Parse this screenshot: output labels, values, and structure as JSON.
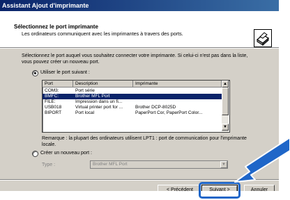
{
  "window": {
    "title": "Assistant Ajout d'imprimante"
  },
  "header": {
    "title": "Sélectionnez le port imprimante",
    "subtitle": "Les ordinateurs communiquent avec les imprimantes à travers des ports.",
    "icon": "printer-icon"
  },
  "instructions": "Sélectionnez le port auquel vous souhaitez connecter votre imprimante. Si celui-ci n'est pas dans la liste, vous pouvez créer un nouveau port.",
  "options": {
    "use_port": {
      "label": "Utiliser le port suivant :",
      "selected": true
    },
    "create_port": {
      "label": "Créer un nouveau port :",
      "selected": false
    }
  },
  "port_list": {
    "columns": [
      "Port",
      "Description",
      "Imprimante"
    ],
    "rows": [
      {
        "port": "COM3:",
        "description": "Port série",
        "printer": "",
        "selected": false
      },
      {
        "port": "BMFC:",
        "description": "Brother MFL Port",
        "printer": "",
        "selected": true
      },
      {
        "port": "FILE:",
        "description": "Impression dans un fi...",
        "printer": "",
        "selected": false
      },
      {
        "port": "USB018",
        "description": "Virtual printer port for ...",
        "printer": "Brother DCP-8025D",
        "selected": false
      },
      {
        "port": "BIPORT",
        "description": "Port local",
        "printer": "PaperPort Cor, PaperPort Color...",
        "selected": false
      }
    ]
  },
  "remark": "Remarque : la plupart des ordinateurs utilisent LPT1 : port de communication pour l'imprimante locale.",
  "new_port": {
    "type_label": "Type :",
    "type_value": "Brother MFL Port"
  },
  "buttons": {
    "back": "< Précédent",
    "next": "Suivant >",
    "cancel": "Annuler"
  },
  "colors": {
    "title_bar": "#0a246a",
    "selection": "#0a246a",
    "callout": "#1f66c8"
  }
}
